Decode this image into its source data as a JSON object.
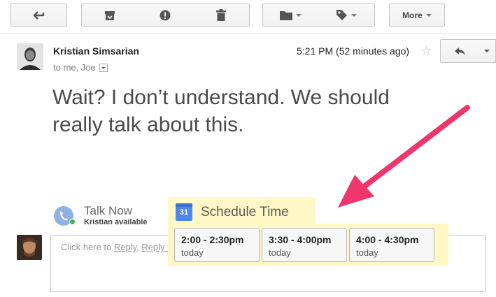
{
  "toolbar": {
    "more_label": "More",
    "icons": [
      "back-arrow-icon",
      "archive-icon",
      "report-spam-icon",
      "delete-icon",
      "folder-icon",
      "label-icon"
    ]
  },
  "message": {
    "sender": "Kristian Simsarian",
    "to": "to me, Joe",
    "timestamp": "5:21 PM (52 minutes ago)",
    "body": "Wait? I don’t understand. We should really talk about this."
  },
  "talk": {
    "label": "Talk Now",
    "status": "Kristian available"
  },
  "schedule": {
    "title": "Schedule Time",
    "calendar_day": "31",
    "slots": [
      {
        "time": "2:00 - 2:30pm",
        "day": "today"
      },
      {
        "time": "3:30 - 4:00pm",
        "day": "today"
      },
      {
        "time": "4:00 - 4:30pm",
        "day": "today"
      }
    ]
  },
  "reply": {
    "prefix": "Click here to ",
    "reply_link": "Reply",
    "separator": ", ",
    "reply_all_link": "Reply to all"
  },
  "colors": {
    "highlight": "#fff8c6",
    "arrow": "#f0346c",
    "online": "#3fb34f"
  }
}
